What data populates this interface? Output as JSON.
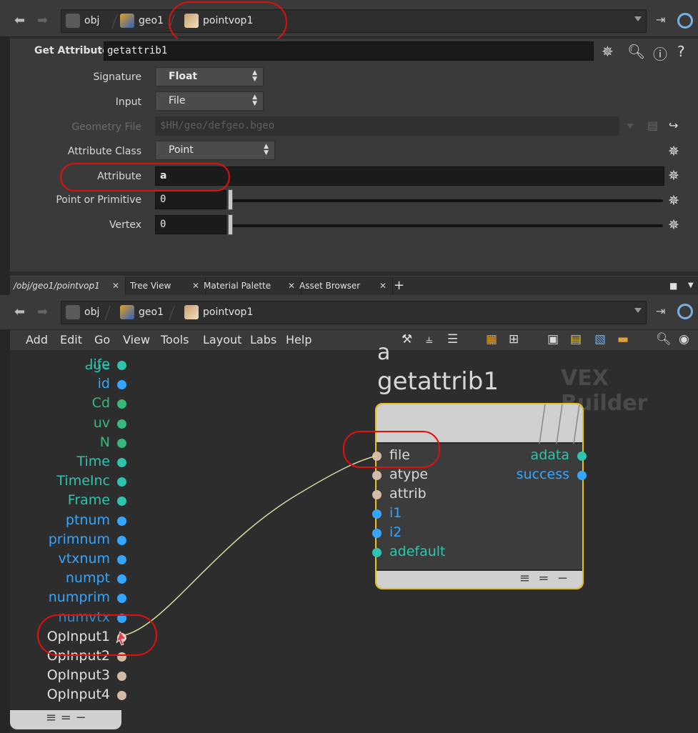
{
  "top_path": {
    "crumbs": [
      "obj",
      "geo1",
      "pointvop1"
    ]
  },
  "param_header": {
    "label": "Get Attribute",
    "node_name": "getattrib1"
  },
  "params": [
    {
      "label": "Signature",
      "value": "Float",
      "type": "menu"
    },
    {
      "label": "Input",
      "value": "File",
      "type": "menu"
    },
    {
      "label": "Geometry File",
      "value": "$HH/geo/defgeo.bgeo",
      "type": "file",
      "disabled": true
    },
    {
      "label": "Attribute Class",
      "value": "Point",
      "type": "menu"
    },
    {
      "label": "Attribute",
      "value": "a",
      "type": "string"
    },
    {
      "label": "Point or Primitive",
      "value": "0",
      "type": "int_slider"
    },
    {
      "label": "Vertex",
      "value": "0",
      "type": "int_slider"
    }
  ],
  "tabs": [
    {
      "label": "/obj/geo1/pointvop1",
      "active": true
    },
    {
      "label": "Tree View"
    },
    {
      "label": "Material Palette"
    },
    {
      "label": "Asset Browser"
    }
  ],
  "tab_add": "+",
  "net_path": {
    "crumbs": [
      "obj",
      "geo1",
      "pointvop1"
    ]
  },
  "menus": [
    "Add",
    "Edit",
    "Go",
    "View",
    "Tools",
    "Layout",
    "Labs",
    "Help"
  ],
  "network": {
    "context_label": "VEX Builder",
    "global_outputs": [
      {
        "name": "life",
        "color": "#2ec4b0"
      },
      {
        "name": "id",
        "color": "#35a6ff"
      },
      {
        "name": "Cd",
        "color": "#38b87a"
      },
      {
        "name": "uv",
        "color": "#38b87a"
      },
      {
        "name": "N",
        "color": "#38b87a"
      },
      {
        "name": "Time",
        "color": "#2ec4b0"
      },
      {
        "name": "TimeInc",
        "color": "#2ec4b0"
      },
      {
        "name": "Frame",
        "color": "#2ec4b0"
      },
      {
        "name": "ptnum",
        "color": "#35a6ff"
      },
      {
        "name": "primnum",
        "color": "#35a6ff"
      },
      {
        "name": "vtxnum",
        "color": "#35a6ff"
      },
      {
        "name": "numpt",
        "color": "#35a6ff"
      },
      {
        "name": "numprim",
        "color": "#35a6ff"
      },
      {
        "name": "numvtx",
        "color": "#35a6ff"
      },
      {
        "name": "OpInput1",
        "color": "#e0c4b0"
      },
      {
        "name": "OpInput2",
        "color": "#d4bba8"
      },
      {
        "name": "OpInput3",
        "color": "#d4bba8"
      },
      {
        "name": "OpInput4",
        "color": "#d4bba8"
      }
    ],
    "node": {
      "comment": "a",
      "name": "getattrib1",
      "inputs": [
        {
          "name": "file",
          "color": "#d4bba8"
        },
        {
          "name": "atype",
          "color": "#d4bba8"
        },
        {
          "name": "attrib",
          "color": "#d4bba8"
        },
        {
          "name": "i1",
          "color": "#35a6ff"
        },
        {
          "name": "i2",
          "color": "#35a6ff"
        },
        {
          "name": "adefault",
          "color": "#2ec4b0"
        }
      ],
      "outputs": [
        {
          "name": "adata",
          "color": "#2ec4b0"
        },
        {
          "name": "success",
          "color": "#35a6ff"
        }
      ]
    }
  },
  "colors": {
    "node_outline": "#e8c022",
    "wire": "#d8d8a0",
    "annotation": "#e01010"
  }
}
